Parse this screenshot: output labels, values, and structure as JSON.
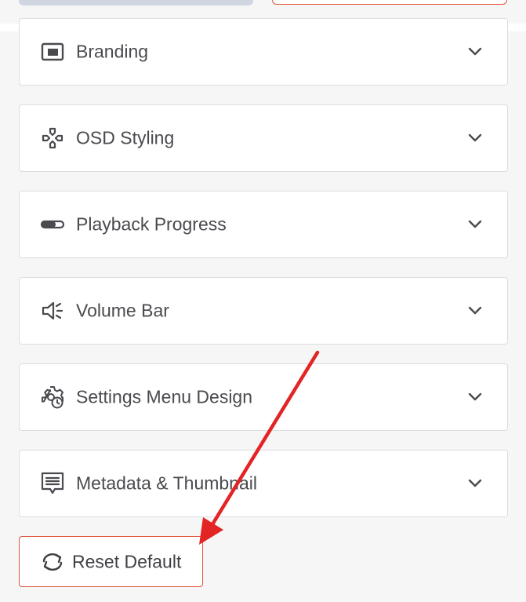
{
  "accordion": {
    "items": [
      {
        "label": "Branding",
        "icon": "branding-icon"
      },
      {
        "label": "OSD Styling",
        "icon": "osd-styling-icon"
      },
      {
        "label": "Playback Progress",
        "icon": "playback-progress-icon"
      },
      {
        "label": "Volume Bar",
        "icon": "volume-bar-icon"
      },
      {
        "label": "Settings Menu Design",
        "icon": "settings-menu-icon"
      },
      {
        "label": "Metadata & Thumbnail",
        "icon": "metadata-thumbnail-icon"
      }
    ],
    "expand_icon": "chevron-down-icon"
  },
  "reset": {
    "label": "Reset Default",
    "icon": "refresh-icon"
  },
  "colors": {
    "accent": "#e2553f",
    "annotation_arrow": "#e22424",
    "text": "#4a4a4f",
    "border": "#dcdde1"
  }
}
